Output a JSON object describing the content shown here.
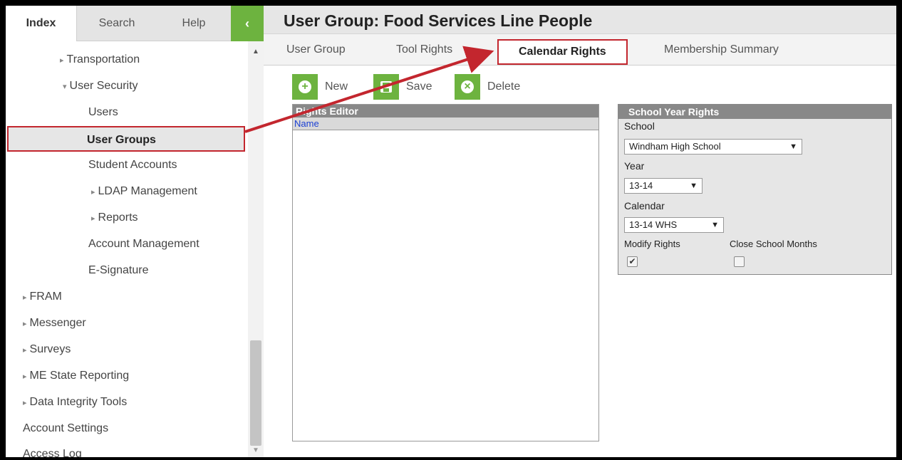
{
  "sidebar": {
    "tabs": [
      {
        "label": "Index"
      },
      {
        "label": "Search"
      },
      {
        "label": "Help"
      }
    ],
    "collapse_glyph": "‹",
    "tree": [
      {
        "label": "Transportation",
        "caret": "▸"
      },
      {
        "label": "User Security",
        "caret": "▾"
      },
      {
        "label": "Users"
      },
      {
        "label": "User Groups"
      },
      {
        "label": "Student Accounts"
      },
      {
        "label": "LDAP Management",
        "caret": "▸"
      },
      {
        "label": "Reports",
        "caret": "▸"
      },
      {
        "label": "Account Management"
      },
      {
        "label": "E-Signature"
      },
      {
        "label": "FRAM",
        "caret": "▸"
      },
      {
        "label": "Messenger",
        "caret": "▸"
      },
      {
        "label": "Surveys",
        "caret": "▸"
      },
      {
        "label": "ME State Reporting",
        "caret": "▸"
      },
      {
        "label": "Data Integrity Tools",
        "caret": "▸"
      },
      {
        "label": "Account Settings"
      },
      {
        "label": "Access Log"
      }
    ]
  },
  "main": {
    "title": "User Group: Food Services Line People",
    "tabs": [
      {
        "label": "User Group"
      },
      {
        "label": "Tool Rights"
      },
      {
        "label": "Calendar Rights"
      },
      {
        "label": "Membership Summary"
      }
    ],
    "toolbar": {
      "new_label": "New",
      "save_label": "Save",
      "delete_label": "Delete"
    },
    "rights_editor": {
      "title": "Rights Editor",
      "column": "Name"
    },
    "school_year_rights": {
      "title": "School Year Rights",
      "school_label": "School",
      "school_value": "Windham High School",
      "year_label": "Year",
      "year_value": "13-14",
      "calendar_label": "Calendar",
      "calendar_value": "13-14 WHS",
      "modify_label": "Modify Rights",
      "close_label": "Close School Months",
      "modify_checked": true,
      "close_checked": false
    }
  },
  "colors": {
    "accent_green": "#6db33f",
    "highlight_red": "#c3262e",
    "link_blue": "#1a3fd4"
  }
}
